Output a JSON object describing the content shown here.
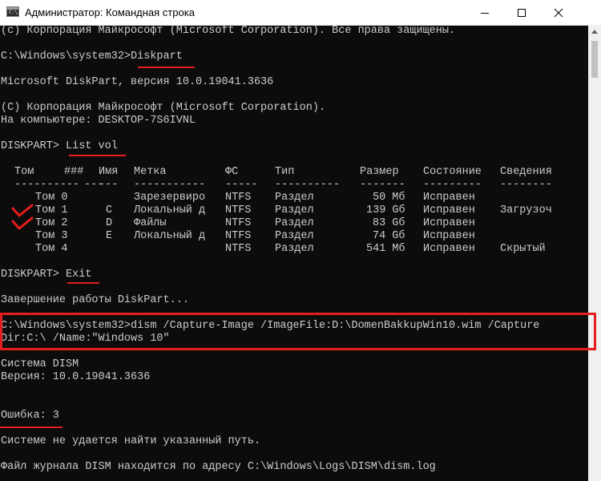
{
  "window": {
    "title": "Администратор: Командная строка",
    "icon_text": "C:\\.",
    "controls": [
      "minimize-icon",
      "maximize-icon",
      "close-icon"
    ]
  },
  "console": {
    "lines": {
      "l1": "(c) Корпорация Майкрософт (Microsoft Corporation). Все права защищены.",
      "l2": "C:\\Windows\\system32>Diskpart",
      "l3": "Microsoft DiskPart, версия 10.0.19041.3636",
      "l4": "(С) Корпорация Майкрософт (Microsoft Corporation).",
      "l5": "На компьютере: DESKTOP-7S6IVNL",
      "l6": "DISKPART> List vol",
      "l7": "DISKPART> Exit",
      "l8": "Завершение работы DiskPart...",
      "l9": "C:\\Windows\\system32>dism /Capture-Image /ImageFile:D:\\DomenBakkupWin10.wim /Capture",
      "l10": "Dir:C:\\ /Name:\"Windows 10\"",
      "l11": "Система DISM",
      "l12": "Версия: 10.0.19041.3636",
      "l13": "Ошибка: 3",
      "l14": "Системе не удается найти указанный путь.",
      "l15": "Файл журнала DISM находится по адресу C:\\Windows\\Logs\\DISM\\dism.log"
    },
    "volume_table": {
      "headers": {
        "tom": "Том",
        "num": "###",
        "letter": "Имя",
        "label": "Метка",
        "fs": "ФС",
        "type": "Тип",
        "size": "Размер",
        "status": "Состояние",
        "info": "Сведения"
      },
      "separators": {
        "tom": "----------",
        "num": "---",
        "letter": "---",
        "label": "-----------",
        "fs": "-----",
        "type": "----------",
        "size": "-------",
        "status": "---------",
        "info": "--------"
      },
      "rows": [
        {
          "vol": "Том 0",
          "letter": "",
          "label": "Зарезервиро",
          "fs": "NTFS",
          "type": "Раздел",
          "size": "50 Мб",
          "status": "Исправен",
          "info": ""
        },
        {
          "vol": "Том 1",
          "letter": "C",
          "label": "Локальный д",
          "fs": "NTFS",
          "type": "Раздел",
          "size": "139 Gб",
          "status": "Исправен",
          "info": "Загрузоч"
        },
        {
          "vol": "Том 2",
          "letter": "D",
          "label": "Файлы",
          "fs": "NTFS",
          "type": "Раздел",
          "size": "83 Gб",
          "status": "Исправен",
          "info": ""
        },
        {
          "vol": "Том 3",
          "letter": "E",
          "label": "Локальный д",
          "fs": "NTFS",
          "type": "Раздел",
          "size": "74 Gб",
          "status": "Исправен",
          "info": ""
        },
        {
          "vol": "Том 4",
          "letter": "",
          "label": "",
          "fs": "NTFS",
          "type": "Раздел",
          "size": "541 Мб",
          "status": "Исправен",
          "info": "Скрытый"
        }
      ]
    }
  },
  "colors": {
    "console_bg": "#0c0c0c",
    "console_text": "#cccccc",
    "annotation_red": "#e41e1e"
  }
}
